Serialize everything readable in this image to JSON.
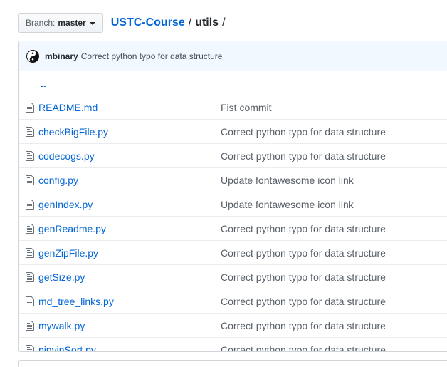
{
  "branch": {
    "label": "Branch:",
    "value": "master"
  },
  "breadcrumb": {
    "repo": "USTC-Course",
    "separator": "/",
    "dir": "utils",
    "trailing": "/"
  },
  "latest_commit": {
    "author": "mbinary",
    "message": "Correct python typo for data structure"
  },
  "parent_dir": "..",
  "files": [
    {
      "name": "README.md",
      "message": "Fist commit"
    },
    {
      "name": "checkBigFile.py",
      "message": "Correct python typo for data structure"
    },
    {
      "name": "codecogs.py",
      "message": "Correct python typo for data structure"
    },
    {
      "name": "config.py",
      "message": "Update fontawesome icon link"
    },
    {
      "name": "genIndex.py",
      "message": "Update fontawesome icon link"
    },
    {
      "name": "genReadme.py",
      "message": "Correct python typo for data structure"
    },
    {
      "name": "genZipFile.py",
      "message": "Correct python typo for data structure"
    },
    {
      "name": "getSize.py",
      "message": "Correct python typo for data structure"
    },
    {
      "name": "md_tree_links.py",
      "message": "Correct python typo for data structure"
    },
    {
      "name": "mywalk.py",
      "message": "Correct python typo for data structure"
    },
    {
      "name": "pinyinSort.py",
      "message": "Correct python typo for data structure"
    }
  ],
  "icons": {
    "file": "file-icon",
    "avatar": "yin-yang-icon",
    "branch_menu": "caret-down-icon"
  },
  "colors": {
    "link": "#0366d6",
    "commit_bar": "#f1f8ff",
    "border": "#d1d5da"
  }
}
